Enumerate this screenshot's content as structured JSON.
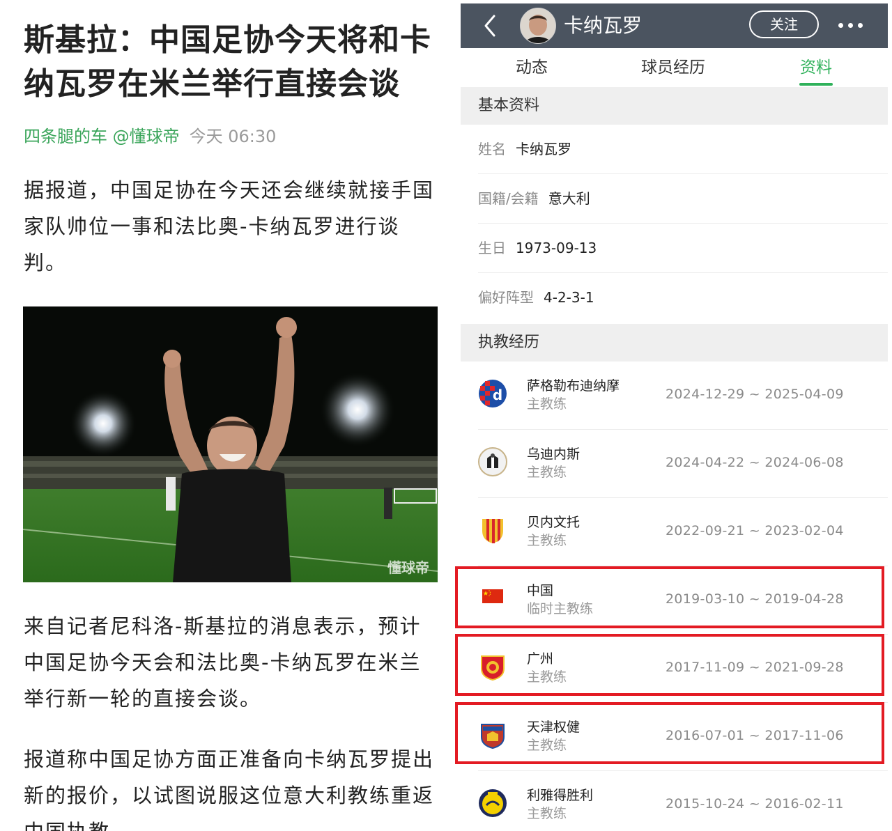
{
  "article": {
    "headline": "斯基拉：中国足协今天将和卡纳瓦罗在米兰举行直接会谈",
    "author": "四条腿的车 @懂球帝",
    "time": "今天 06:30",
    "paragraphs": [
      "据报道，中国足协在今天还会继续就接手国家队帅位一事和法比奥-卡纳瓦罗进行谈判。",
      "来自记者尼科洛-斯基拉的消息表示，预计中国足协今天会和法比奥-卡纳瓦罗在米兰举行新一轮的直接会谈。",
      "报道称中国足协方面正准备向卡纳瓦罗提出新的报价，以试图说服这位意大利教练重返中国执教。"
    ],
    "photo_watermark": "懂球帝"
  },
  "profile": {
    "name": "卡纳瓦罗",
    "follow_label": "关注",
    "tabs": [
      "动态",
      "球员经历",
      "资料"
    ],
    "active_tab": "资料",
    "basic_header": "基本资料",
    "basic_info": [
      {
        "label": "姓名",
        "value": "卡纳瓦罗"
      },
      {
        "label": "国籍/会籍",
        "value": "意大利"
      },
      {
        "label": "生日",
        "value": "1973-09-13"
      },
      {
        "label": "偏好阵型",
        "value": "4-2-3-1"
      }
    ],
    "coaching_header": "执教经历",
    "coaching": [
      {
        "club": "萨格勒布迪纳摩",
        "role": "主教练",
        "dates": "2024-12-29 ~ 2025-04-09",
        "logo": "dinamo-zagreb-logo",
        "highlighted": false
      },
      {
        "club": "乌迪内斯",
        "role": "主教练",
        "dates": "2024-04-22 ~ 2024-06-08",
        "logo": "udinese-logo",
        "highlighted": false
      },
      {
        "club": "贝内文托",
        "role": "主教练",
        "dates": "2022-09-21 ~ 2023-02-04",
        "logo": "benevento-logo",
        "highlighted": false
      },
      {
        "club": "中国",
        "role": "临时主教练",
        "dates": "2019-03-10 ~ 2019-04-28",
        "logo": "china-flag",
        "highlighted": true
      },
      {
        "club": "广州",
        "role": "主教练",
        "dates": "2017-11-09 ~ 2021-09-28",
        "logo": "guangzhou-logo",
        "highlighted": true
      },
      {
        "club": "天津权健",
        "role": "主教练",
        "dates": "2016-07-01 ~ 2017-11-06",
        "logo": "tianjin-quanjian-logo",
        "highlighted": true
      },
      {
        "club": "利雅得胜利",
        "role": "主教练",
        "dates": "2015-10-24 ~ 2016-02-11",
        "logo": "al-nassr-logo",
        "highlighted": false
      }
    ]
  },
  "colors": {
    "accent_green": "#2fb15a",
    "topbar": "#4b5460",
    "highlight_red": "#e31b23"
  }
}
